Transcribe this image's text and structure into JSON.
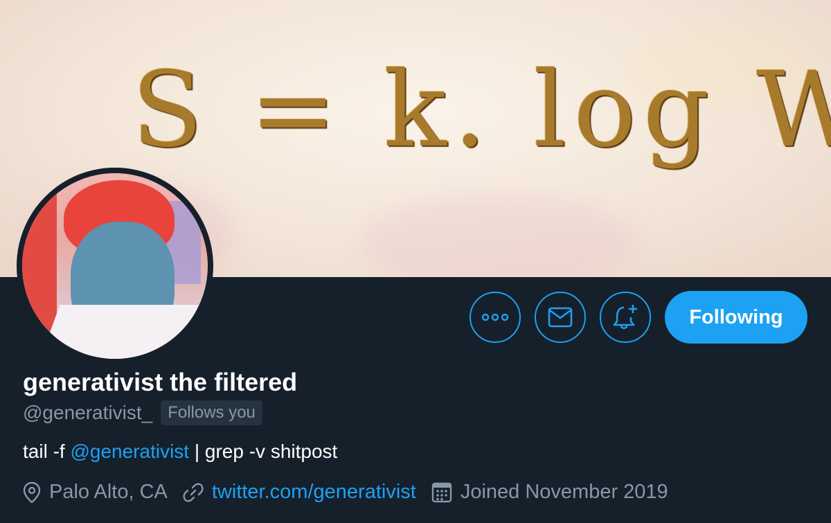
{
  "banner": {
    "formula": "S = k. log W"
  },
  "profile": {
    "display_name": "generativist the filtered",
    "handle": "@generativist_",
    "follows_you": "Follows you",
    "bio_prefix": "tail -f ",
    "bio_mention": "@generativist",
    "bio_suffix": " | grep -v shitpost",
    "location": "Palo Alto, CA",
    "website": "twitter.com/generativist",
    "joined": "Joined November 2019"
  },
  "actions": {
    "more_icon": "more-dots-icon",
    "message_icon": "envelope-icon",
    "notify_icon": "bell-plus-icon",
    "follow_label": "Following"
  },
  "colors": {
    "background": "#15202b",
    "accent": "#1da1f2",
    "secondary_text": "#8899a6",
    "badge_bg": "#253341"
  }
}
